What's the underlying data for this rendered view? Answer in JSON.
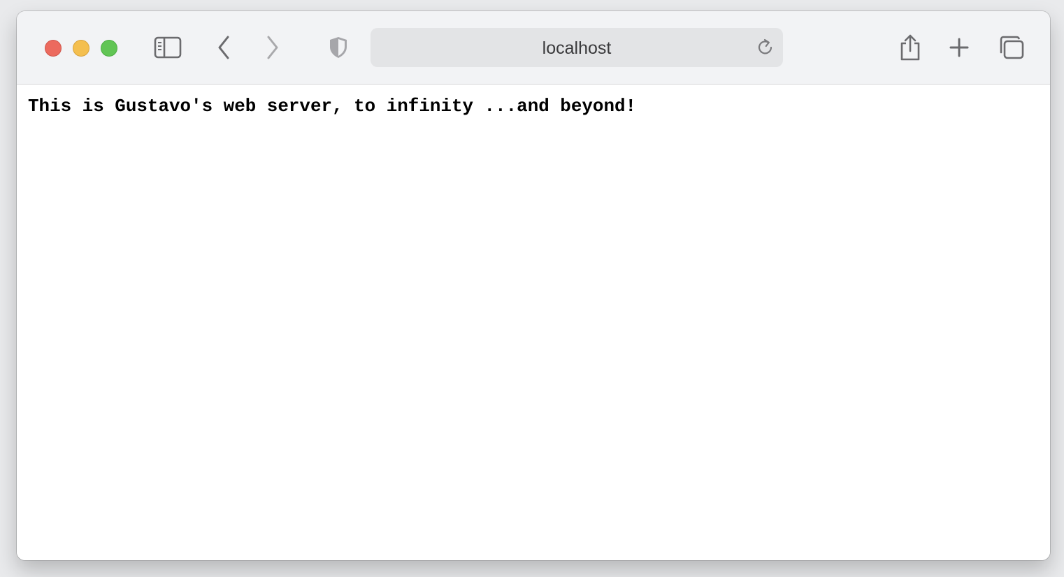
{
  "browser": {
    "address_bar": {
      "url_text": "localhost"
    },
    "icons": {
      "sidebar": "sidebar-icon",
      "back": "chevron-left-icon",
      "forward": "chevron-right-icon",
      "privacy": "shield-icon",
      "reload": "reload-icon",
      "share": "share-icon",
      "new_tab": "plus-icon",
      "tab_overview": "tabs-icon"
    },
    "colors": {
      "close": "#ec6a5e",
      "minimize": "#f4bf4f",
      "zoom": "#61c554",
      "toolbar_bg": "#f2f3f5",
      "address_bg": "#e3e4e6"
    }
  },
  "page": {
    "body_text": "This is Gustavo's web server, to infinity ...and beyond!"
  }
}
